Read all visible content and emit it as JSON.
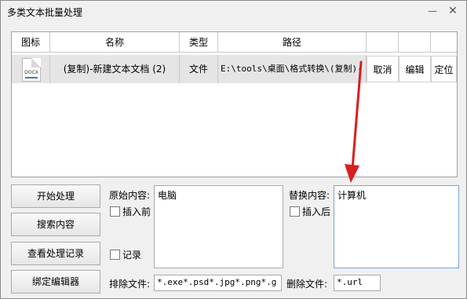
{
  "window": {
    "title": "多类文本批量处理",
    "minimize_label": "—",
    "close_label": "✕"
  },
  "table": {
    "headers": [
      "图标",
      "名称",
      "类型",
      "路径",
      "",
      "",
      ""
    ],
    "rows": [
      {
        "icon": "word-document-icon",
        "icon_label": "DOCX",
        "name": "(复制)-新建文本文档 (2)",
        "type": "文件",
        "path": "E:\\tools\\桌面\\格式转换\\(复制)-",
        "actions": [
          "取消",
          "编辑",
          "定位"
        ]
      }
    ]
  },
  "buttons": {
    "start": "开始处理",
    "search": "搜索内容",
    "history": "查看处理记录",
    "bind_editor": "绑定编辑器"
  },
  "fields": {
    "original_label": "原始内容:",
    "original_value": "电脑",
    "insert_before_label": "插入前",
    "record_label": "记录",
    "replace_label": "替换内容:",
    "replace_value": "计算机",
    "insert_after_label": "插入后",
    "exclude_label": "排除文件:",
    "exclude_value": "*.exe*.psd*.jpg*.png*.g",
    "delete_label": "删除文件:",
    "delete_value": "*.url"
  },
  "colors": {
    "annotation_arrow": "#d81e1e"
  }
}
